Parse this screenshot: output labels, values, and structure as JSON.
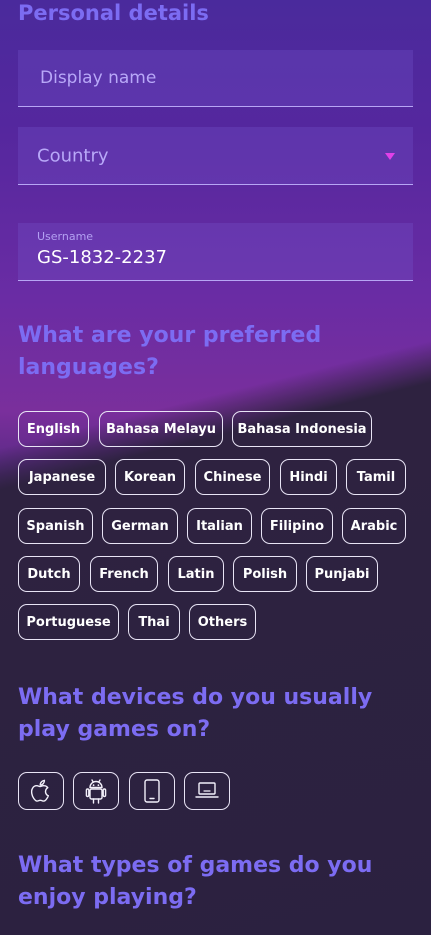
{
  "personal": {
    "title": "Personal details",
    "display_name_placeholder": "Display name",
    "country_placeholder": "Country",
    "username_label": "Username",
    "username_value": "GS-1832-2237"
  },
  "languages": {
    "title": "What are your preferred languages?",
    "options": [
      "English",
      "Bahasa Melayu",
      "Bahasa Indonesia",
      "Japanese",
      "Korean",
      "Chinese",
      "Hindi",
      "Tamil",
      "Spanish",
      "German",
      "Italian",
      "Filipino",
      "Arabic",
      "Dutch",
      "French",
      "Latin",
      "Polish",
      "Punjabi",
      "Portuguese",
      "Thai",
      "Others"
    ]
  },
  "devices": {
    "title": "What devices do you usually play games on?",
    "options": [
      "apple-icon",
      "android-icon",
      "tablet-icon",
      "laptop-icon"
    ]
  },
  "game_types": {
    "title": "What types of games do you enjoy playing?"
  },
  "colors": {
    "accent": "#7c6cf2",
    "caret": "#e040e8",
    "chip_border": "#e8e4f5"
  }
}
